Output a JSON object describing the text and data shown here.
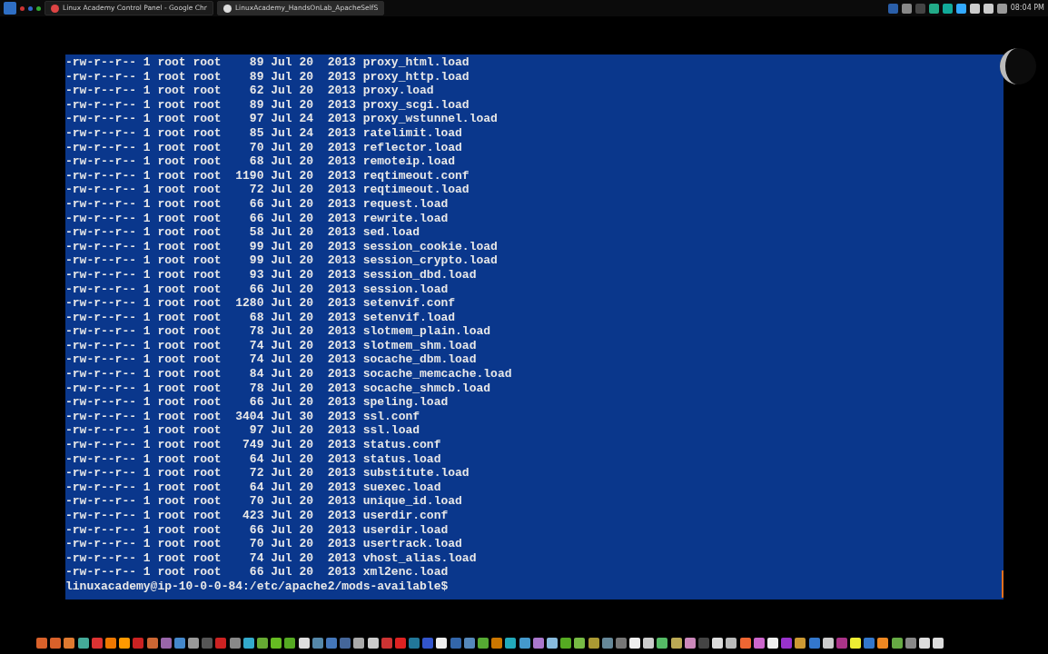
{
  "taskbar": {
    "tabs": [
      {
        "label": "Linux Academy Control Panel - Google Chr",
        "selected": false
      },
      {
        "label": "LinuxAcademy_HandsOnLab_ApacheSelfS",
        "selected": true
      }
    ],
    "clock": "08:04 PM"
  },
  "terminal": {
    "lines": [
      "-rw-r--r-- 1 root root    89 Jul 20  2013 proxy_html.load",
      "-rw-r--r-- 1 root root    89 Jul 20  2013 proxy_http.load",
      "-rw-r--r-- 1 root root    62 Jul 20  2013 proxy.load",
      "-rw-r--r-- 1 root root    89 Jul 20  2013 proxy_scgi.load",
      "-rw-r--r-- 1 root root    97 Jul 24  2013 proxy_wstunnel.load",
      "-rw-r--r-- 1 root root    85 Jul 24  2013 ratelimit.load",
      "-rw-r--r-- 1 root root    70 Jul 20  2013 reflector.load",
      "-rw-r--r-- 1 root root    68 Jul 20  2013 remoteip.load",
      "-rw-r--r-- 1 root root  1190 Jul 20  2013 reqtimeout.conf",
      "-rw-r--r-- 1 root root    72 Jul 20  2013 reqtimeout.load",
      "-rw-r--r-- 1 root root    66 Jul 20  2013 request.load",
      "-rw-r--r-- 1 root root    66 Jul 20  2013 rewrite.load",
      "-rw-r--r-- 1 root root    58 Jul 20  2013 sed.load",
      "-rw-r--r-- 1 root root    99 Jul 20  2013 session_cookie.load",
      "-rw-r--r-- 1 root root    99 Jul 20  2013 session_crypto.load",
      "-rw-r--r-- 1 root root    93 Jul 20  2013 session_dbd.load",
      "-rw-r--r-- 1 root root    66 Jul 20  2013 session.load",
      "-rw-r--r-- 1 root root  1280 Jul 20  2013 setenvif.conf",
      "-rw-r--r-- 1 root root    68 Jul 20  2013 setenvif.load",
      "-rw-r--r-- 1 root root    78 Jul 20  2013 slotmem_plain.load",
      "-rw-r--r-- 1 root root    74 Jul 20  2013 slotmem_shm.load",
      "-rw-r--r-- 1 root root    74 Jul 20  2013 socache_dbm.load",
      "-rw-r--r-- 1 root root    84 Jul 20  2013 socache_memcache.load",
      "-rw-r--r-- 1 root root    78 Jul 20  2013 socache_shmcb.load",
      "-rw-r--r-- 1 root root    66 Jul 20  2013 speling.load",
      "-rw-r--r-- 1 root root  3404 Jul 30  2013 ssl.conf",
      "-rw-r--r-- 1 root root    97 Jul 20  2013 ssl.load",
      "-rw-r--r-- 1 root root   749 Jul 20  2013 status.conf",
      "-rw-r--r-- 1 root root    64 Jul 20  2013 status.load",
      "-rw-r--r-- 1 root root    72 Jul 20  2013 substitute.load",
      "-rw-r--r-- 1 root root    64 Jul 20  2013 suexec.load",
      "-rw-r--r-- 1 root root    70 Jul 20  2013 unique_id.load",
      "-rw-r--r-- 1 root root   423 Jul 20  2013 userdir.conf",
      "-rw-r--r-- 1 root root    66 Jul 20  2013 userdir.load",
      "-rw-r--r-- 1 root root    70 Jul 20  2013 usertrack.load",
      "-rw-r--r-- 1 root root    74 Jul 20  2013 vhost_alias.load",
      "-rw-r--r-- 1 root root    66 Jul 20  2013 xml2enc.load"
    ],
    "prompt": "linuxacademy@ip-10-0-0-84:/etc/apache2/mods-available$"
  }
}
